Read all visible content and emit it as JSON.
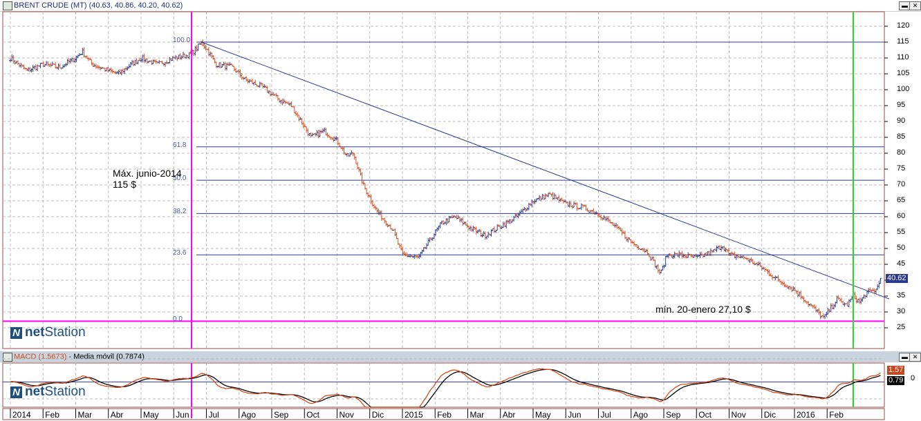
{
  "main_window": {
    "title": "BRENT CRUDE (MT) (40.63, 40.86, 40.20, 40.62)",
    "last_price": "40.62",
    "minimize_icon": "minimize-icon",
    "close_icon": "close-icon"
  },
  "macd_window": {
    "macd_label": "MACD (1.5673)",
    "separator": " - ",
    "ma_label": "Media móvil (0.7874)",
    "macd_value": "1.57",
    "signal_value": "0.79",
    "zero_label": "0"
  },
  "annotations": {
    "max_line1": "Máx. junio-2014",
    "max_line2": "115 $",
    "min_label": "mín. 20-enero 27,10 $"
  },
  "logo": {
    "mark": "N",
    "bold": "net",
    "rest": "Station"
  },
  "colors": {
    "up": "#2b3a8c",
    "down": "#d44a1c",
    "macd": "#d44a1c",
    "signal": "#000000",
    "fib": "#2b3a8c",
    "magenta": "#ff00ff",
    "green": "#22dd22",
    "frame": "#9a4a4a"
  },
  "chart_data": {
    "type": "ohlc",
    "title": "BRENT CRUDE (MT)",
    "ylim": [
      22,
      123
    ],
    "y_ticks": [
      25,
      30,
      35,
      40,
      45,
      50,
      55,
      60,
      65,
      70,
      75,
      80,
      85,
      90,
      95,
      100,
      105,
      110,
      115,
      120
    ],
    "x_ticks": [
      "2014",
      "Feb",
      "Mar",
      "Abr",
      "May",
      "Jun",
      "Jul",
      "Ago",
      "Sep",
      "Oct",
      "Nov",
      "Dic",
      "2015",
      "Feb",
      "Mar",
      "Abr",
      "May",
      "Jun",
      "Jul",
      "Ago",
      "Sep",
      "Oct",
      "Nov",
      "Dic",
      "2016",
      "Feb"
    ],
    "x_unit": "months since Jan 2014",
    "close_path": [
      [
        0,
        110
      ],
      [
        0.5,
        106
      ],
      [
        1,
        108
      ],
      [
        1.5,
        107
      ],
      [
        2,
        110
      ],
      [
        2.2,
        112
      ],
      [
        2.5,
        108
      ],
      [
        3,
        106
      ],
      [
        3.3,
        105
      ],
      [
        3.7,
        108
      ],
      [
        4,
        110
      ],
      [
        4.5,
        108
      ],
      [
        5,
        110
      ],
      [
        5.5,
        111
      ],
      [
        5.7,
        113
      ],
      [
        5.85,
        115
      ],
      [
        6,
        113
      ],
      [
        6.3,
        108
      ],
      [
        6.8,
        107
      ],
      [
        7.2,
        103
      ],
      [
        7.7,
        101
      ],
      [
        8.2,
        97
      ],
      [
        8.6,
        95
      ],
      [
        9.2,
        85
      ],
      [
        9.6,
        87
      ],
      [
        10,
        84
      ],
      [
        10.3,
        79
      ],
      [
        10.5,
        80
      ],
      [
        10.8,
        70
      ],
      [
        11.2,
        62
      ],
      [
        11.7,
        56
      ],
      [
        12,
        48
      ],
      [
        12.5,
        47
      ],
      [
        12.8,
        52
      ],
      [
        13.2,
        58
      ],
      [
        13.6,
        60
      ],
      [
        14,
        57
      ],
      [
        14.5,
        54
      ],
      [
        15,
        57
      ],
      [
        15.5,
        60
      ],
      [
        16,
        65
      ],
      [
        16.5,
        67
      ],
      [
        17,
        64
      ],
      [
        17.5,
        63
      ],
      [
        18,
        61
      ],
      [
        18.5,
        57
      ],
      [
        19,
        52
      ],
      [
        19.5,
        49
      ],
      [
        19.9,
        42
      ],
      [
        20.1,
        48
      ],
      [
        20.5,
        48
      ],
      [
        21,
        47
      ],
      [
        21.5,
        49
      ],
      [
        21.8,
        51
      ],
      [
        22,
        48
      ],
      [
        22.5,
        47
      ],
      [
        23,
        44
      ],
      [
        23.5,
        40
      ],
      [
        24,
        37
      ],
      [
        24.5,
        32
      ],
      [
        24.9,
        28
      ],
      [
        25.3,
        34
      ],
      [
        25.6,
        32
      ],
      [
        25.8,
        35
      ],
      [
        26,
        33
      ],
      [
        26.2,
        36
      ],
      [
        26.5,
        37
      ],
      [
        26.65,
        40.62
      ]
    ],
    "fibonacci": [
      {
        "label": "100.0",
        "value": 115
      },
      {
        "label": "61.8",
        "value": 82
      },
      {
        "label": "50.0",
        "value": 71.5
      },
      {
        "label": "38.2",
        "value": 61
      },
      {
        "label": "23.6",
        "value": 48
      },
      {
        "label": "0.0",
        "value": 27.1
      }
    ],
    "trendline": [
      [
        5.85,
        115
      ],
      [
        26.9,
        34.1
      ]
    ],
    "vertical_markers": [
      {
        "month": 5.75,
        "color": "magenta"
      },
      {
        "month": 25.8,
        "color": "green"
      }
    ],
    "macd": {
      "last": 1.5673,
      "signal_last": 0.7874,
      "ylim": [
        -4,
        3
      ]
    }
  }
}
